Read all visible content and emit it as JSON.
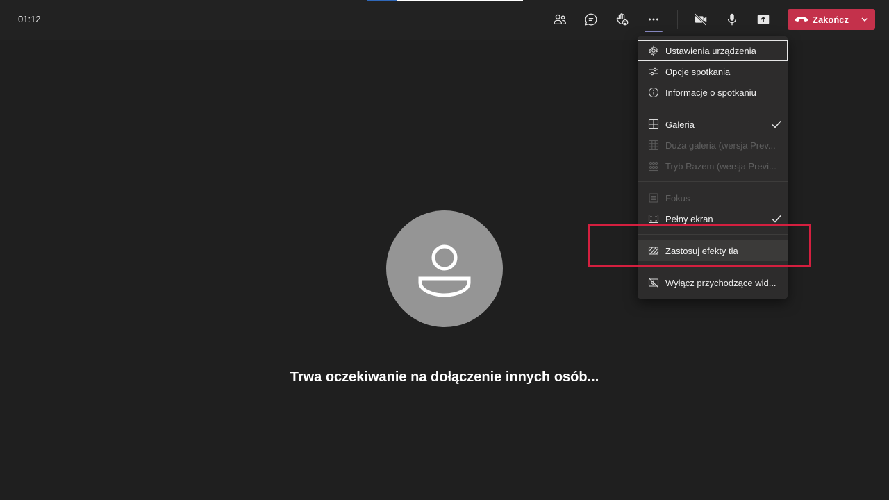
{
  "topbar": {
    "timer": "01:12",
    "buttons": [
      {
        "name": "people",
        "icon": "participants-icon"
      },
      {
        "name": "chat",
        "icon": "chat-icon"
      },
      {
        "name": "reactions",
        "icon": "raise-hand-icon"
      },
      {
        "name": "more",
        "icon": "more-icon"
      },
      {
        "name": "camera",
        "icon": "camera-off-icon"
      },
      {
        "name": "mic",
        "icon": "microphone-icon"
      },
      {
        "name": "share",
        "icon": "share-tray-icon"
      }
    ],
    "end_label": "Zakończ",
    "end_color": "#c4314b"
  },
  "main": {
    "waiting_text": "Trwa oczekiwanie na dołączenie innych osób...",
    "avatar_icon": "person-icon"
  },
  "menu": {
    "items": [
      {
        "label": "Ustawienia urządzenia",
        "icon": "gear-icon",
        "disabled": false,
        "checked": false
      },
      {
        "label": "Opcje spotkania",
        "icon": "sliders-icon",
        "disabled": false,
        "checked": false
      },
      {
        "label": "Informacje o spotkaniu",
        "icon": "info-icon",
        "disabled": false,
        "checked": false
      },
      {
        "label": "Galeria",
        "icon": "grid-icon",
        "disabled": false,
        "checked": true
      },
      {
        "label": "Duża galeria (wersja Prev...",
        "icon": "large-grid-icon",
        "disabled": true,
        "checked": false
      },
      {
        "label": "Tryb Razem (wersja Previ...",
        "icon": "together-mode-icon",
        "disabled": true,
        "checked": false
      },
      {
        "label": "Fokus",
        "icon": "focus-icon",
        "disabled": true,
        "checked": false
      },
      {
        "label": "Pełny ekran",
        "icon": "fullscreen-icon",
        "disabled": false,
        "checked": true
      },
      {
        "label": "Zastosuj efekty tła",
        "icon": "background-effects-icon",
        "disabled": false,
        "checked": false
      },
      {
        "label": "Wyłącz przychodzące wid...",
        "icon": "video-off-icon",
        "disabled": false,
        "checked": false
      }
    ]
  },
  "colors": {
    "background": "#1f1f1f",
    "menu_bg": "#2d2c2c",
    "accent_underline": "#8b8cc7",
    "annotation": "#d41f3f"
  }
}
